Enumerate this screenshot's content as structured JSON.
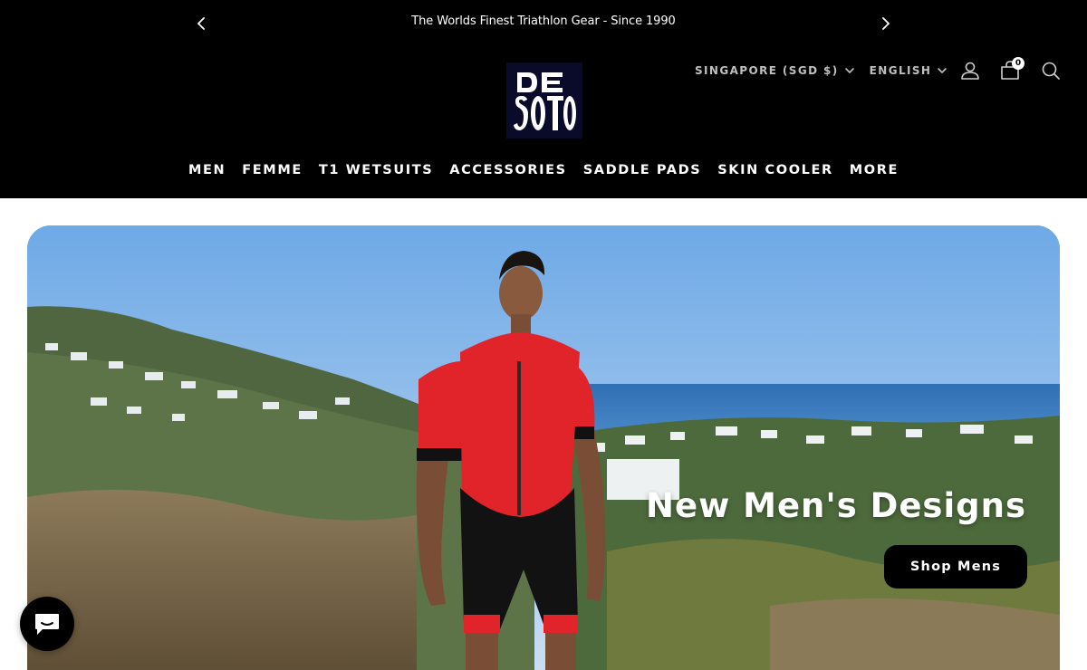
{
  "announcement": {
    "text": "The Worlds Finest Triathlon Gear - Since 1990"
  },
  "brand": {
    "logo_text": "DE SOTO"
  },
  "header": {
    "country_selector": "SINGAPORE (SGD $)",
    "language_selector": "ENGLISH",
    "cart_count": "0"
  },
  "nav": {
    "items": [
      "MEN",
      "FEMME",
      "T1 WETSUITS",
      "ACCESSORIES",
      "SADDLE PADS",
      "SKIN COOLER",
      "MORE"
    ]
  },
  "hero": {
    "title": "New Men's Designs",
    "cta_label": "Shop Mens"
  },
  "colors": {
    "header_bg": "#000000",
    "accent": "#e0242a",
    "sky": "#7fb6ea"
  },
  "icons": [
    "chevron-left-icon",
    "chevron-right-icon",
    "user-icon",
    "cart-icon",
    "search-icon",
    "chat-icon"
  ]
}
